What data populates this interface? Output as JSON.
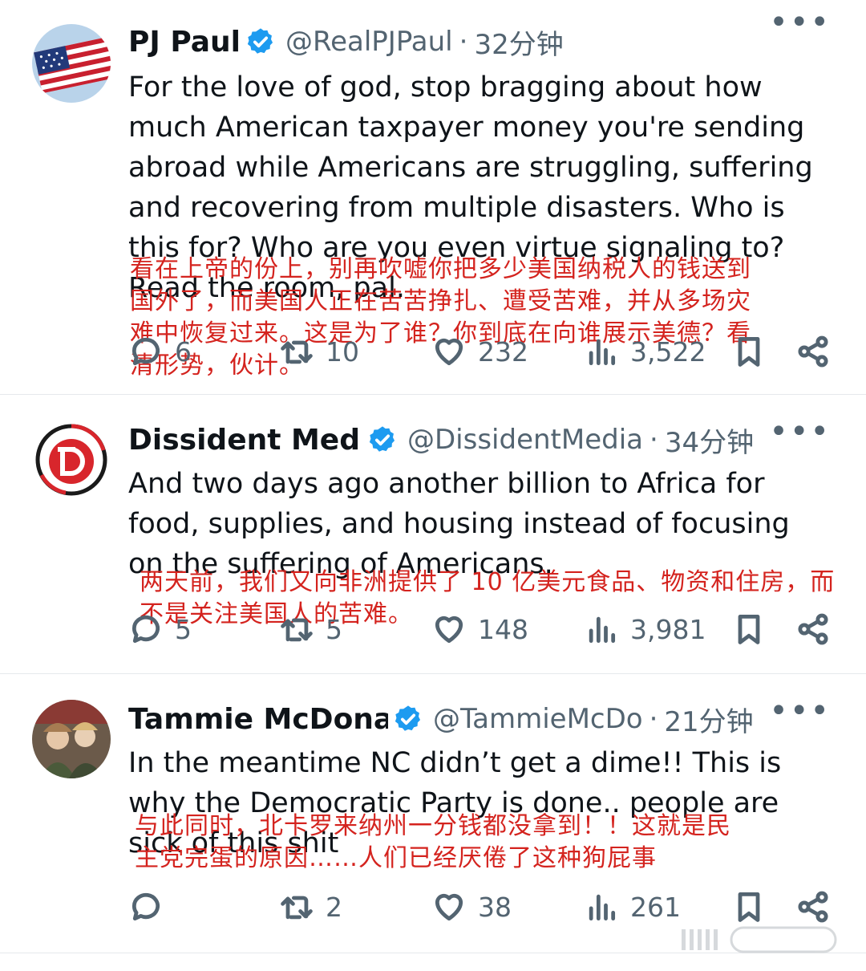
{
  "tweets": [
    {
      "name": "PJ Paul",
      "handle": "@RealPJPaul",
      "time": "32分钟",
      "avatar_icon": "us-flag",
      "text": "For the love of god, stop bragging about how much American taxpayer money you're sending abroad while Americans are struggling, suffering and recovering from multiple disasters. Who is this for? Who are you even virtue signaling to? Read the room, pal.",
      "translation": "看在上帝的份上，别再吹嘘你把多少美国纳税人的钱送到国外了，而美国人正在苦苦挣扎、遭受苦难，并从多场灾难中恢复过来。这是为了谁？你到底在向谁展示美德？看清形势，伙计。",
      "replies": "6",
      "reposts": "10",
      "likes": "232",
      "views": "3,522"
    },
    {
      "name": "Dissident Media",
      "handle": "@DissidentMedia",
      "time": "34分钟",
      "avatar_icon": "dissident-d-logo",
      "text": "And two days ago another billion to Africa for food, supplies, and housing instead of focusing on the suffering of Americans.",
      "translation": "两天前，我们又向非洲提供了 10 亿美元食品、物资和住房，而不是关注美国人的苦难。",
      "replies": "5",
      "reposts": "5",
      "likes": "148",
      "views": "3,981"
    },
    {
      "name": "Tammie McDonald",
      "handle": "@TammieMcDo",
      "time": "21分钟",
      "avatar_icon": "person-photo",
      "text": "In the meantime NC didn’t get a dime!! This is why the Democratic Party is done.. people are sick of this shit",
      "translation": "与此同时，北卡罗来纳州一分钱都没拿到！！这就是民主党完蛋的原因……人们已经厌倦了这种狗屁事",
      "replies": "",
      "reposts": "2",
      "likes": "38",
      "views": "261"
    }
  ],
  "colors": {
    "verified": "#1d9bf0",
    "muted": "#536471",
    "annotation": "#d4231e"
  }
}
